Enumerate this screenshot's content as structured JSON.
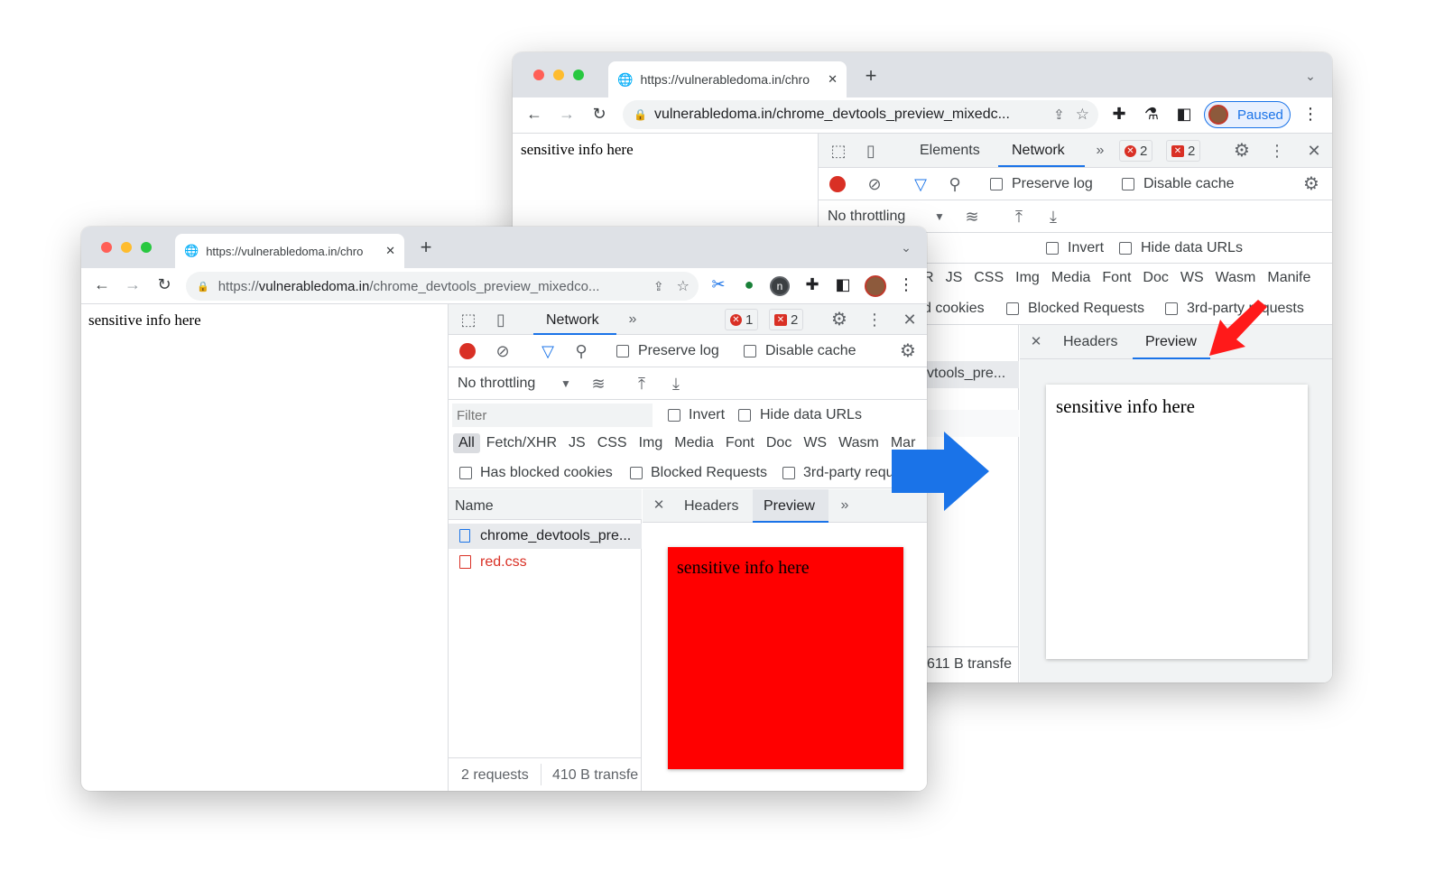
{
  "colors": {
    "accent": "#1a73e8",
    "record": "#d93025",
    "preview_bg": "#ff0000",
    "arrow_blue": "#1a73e8",
    "arrow_red": "#ff1a1a"
  },
  "back": {
    "tab_title": "https://vulnerabledoma.in/chro",
    "url": "vulnerabledoma.in/chrome_devtools_preview_mixedc...",
    "profile_label": "Paused",
    "page_text": "sensitive info here",
    "devtools": {
      "tabs": [
        "Elements",
        "Network"
      ],
      "errors": "2",
      "issues": "2",
      "preserve_log": "Preserve log",
      "disable_cache": "Disable cache",
      "throttling": "No throttling",
      "invert": "Invert",
      "hide_data_urls": "Hide data URLs",
      "types": [
        "R",
        "JS",
        "CSS",
        "Img",
        "Media",
        "Font",
        "Doc",
        "WS",
        "Wasm",
        "Manife"
      ],
      "blocked_cookies": "d cookies",
      "blocked_requests": "Blocked Requests",
      "third_party": "3rd-party requests",
      "request_name": "vtools_pre...",
      "panel_tabs": [
        "Headers",
        "Preview"
      ],
      "preview_text": "sensitive info here",
      "status": "611 B transfe"
    }
  },
  "front": {
    "tab_title": "https://vulnerabledoma.in/chro",
    "url_scheme": "https://",
    "url_host": "vulnerabledoma.in",
    "url_path": "/chrome_devtools_preview_mixedco...",
    "page_text": "sensitive info here",
    "devtools": {
      "tab": "Network",
      "errors": "1",
      "issues": "2",
      "preserve_log": "Preserve log",
      "disable_cache": "Disable cache",
      "throttling": "No throttling",
      "filter_placeholder": "Filter",
      "invert": "Invert",
      "hide_data_urls": "Hide data URLs",
      "types": [
        "All",
        "Fetch/XHR",
        "JS",
        "CSS",
        "Img",
        "Media",
        "Font",
        "Doc",
        "WS",
        "Wasm",
        "Mar"
      ],
      "has_blocked_cookies": "Has blocked cookies",
      "blocked_requests": "Blocked Requests",
      "third_party": "3rd-party requ",
      "name_header": "Name",
      "requests": [
        {
          "name": "chrome_devtools_pre...",
          "type": "document"
        },
        {
          "name": "red.css",
          "type": "stylesheet"
        }
      ],
      "panel_tabs": [
        "Headers",
        "Preview"
      ],
      "preview_text": "sensitive info here",
      "status_requests": "2 requests",
      "status_transfer": "410 B transfe"
    }
  }
}
